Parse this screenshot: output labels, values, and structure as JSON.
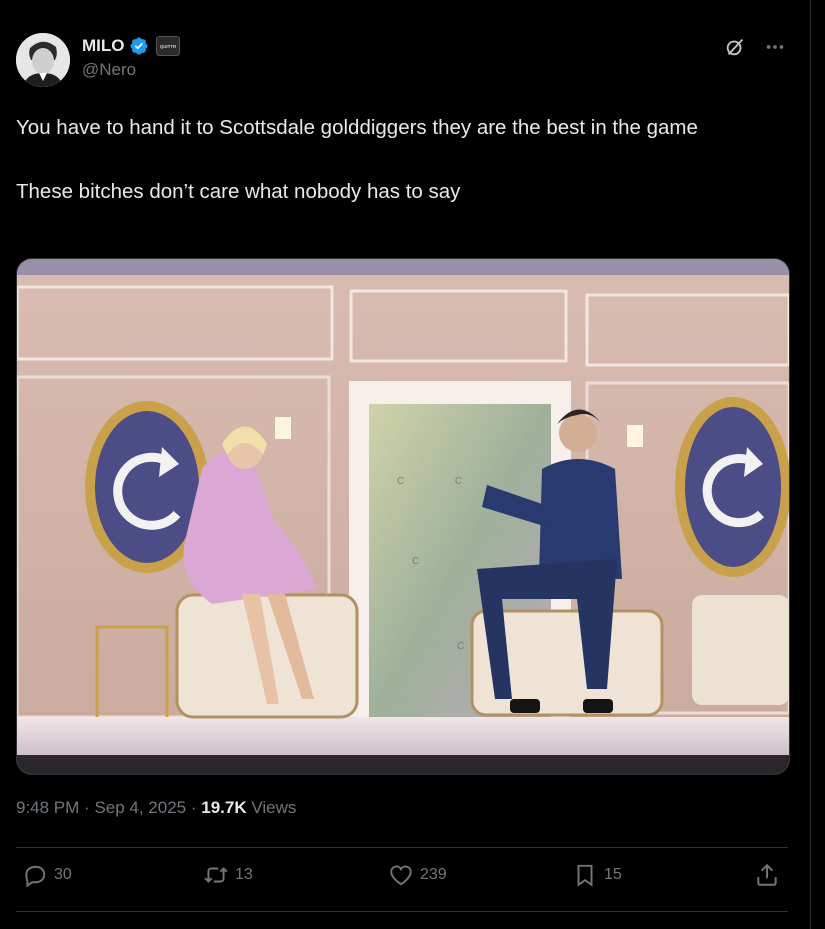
{
  "author": {
    "display_name": "MILO",
    "handle": "@Nero",
    "affiliation_badge": "QUITTR"
  },
  "tweet": {
    "text_lines": [
      "You have to hand it to Scottsdale golddiggers they are the best in the game",
      "These bitches don’t care what nobody has to say"
    ],
    "time": "9:48 PM",
    "date": "Sep 4, 2025",
    "views_count": "19.7K",
    "views_label": "Views"
  },
  "actions": {
    "replies": "30",
    "reposts": "13",
    "likes": "239",
    "bookmarks": "15"
  },
  "icons": {
    "verified": "verified-badge-icon",
    "grok": "grok-icon",
    "more": "more-icon",
    "reply": "reply-icon",
    "repost": "repost-icon",
    "like": "like-icon",
    "bookmark": "bookmark-icon",
    "share": "share-icon"
  },
  "colors": {
    "background": "#000000",
    "text_primary": "#e7e9ea",
    "text_secondary": "#71767b",
    "verified_blue": "#1d9bf0",
    "divider": "#2f3336"
  }
}
